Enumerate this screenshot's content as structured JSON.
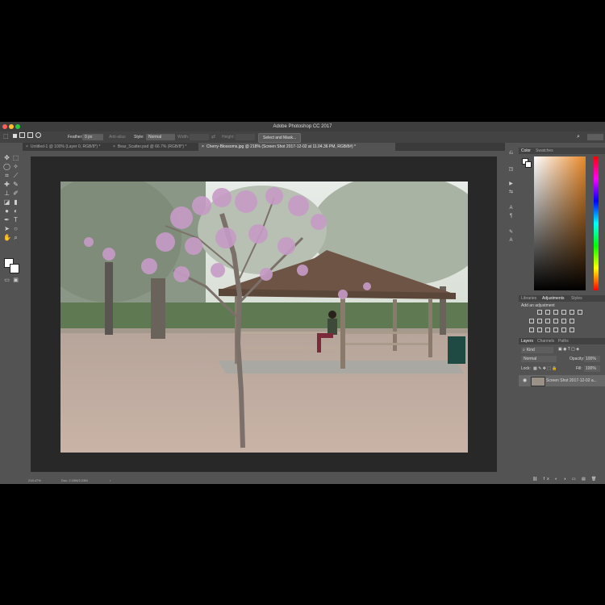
{
  "app": {
    "title": "Adobe Photoshop CC 2017"
  },
  "options": {
    "feather_label": "Feather:",
    "feather_value": "0 px",
    "antialias_label": "Anti-alias",
    "style_label": "Style:",
    "style_value": "Normal",
    "width_label": "Width:",
    "height_label": "Height:",
    "select_mask_label": "Select and Mask..."
  },
  "tabs": [
    {
      "label": "Untitled-1 @ 100% (Layer 0, RGB/8*) *"
    },
    {
      "label": "Bear_Scatter.psd @ 66.7% (RGB/8*) *"
    },
    {
      "label": "Cherry-Blossoms.jpg @ 218% (Screen Shot 2017-12-02 at 11.04.36 PM, RGB/8#) *"
    }
  ],
  "status": {
    "zoom": "218.47%",
    "doc": "Doc: 2.03M/2.03M"
  },
  "panels": {
    "color_tab": "Color",
    "swatches_tab": "Swatches",
    "libraries_tab": "Libraries",
    "adjustments_tab": "Adjustments",
    "styles_tab": "Styles",
    "add_adjustment": "Add an adjustment",
    "layers_tab": "Layers",
    "channels_tab": "Channels",
    "paths_tab": "Paths",
    "kind_filter": "Kind",
    "blend_mode": "Normal",
    "opacity_label": "Opacity:",
    "opacity_value": "100%",
    "lock_label": "Lock:",
    "fill_label": "Fill:",
    "fill_value": "100%",
    "layer_name": "Screen Shot 2017-12-02 a..."
  }
}
